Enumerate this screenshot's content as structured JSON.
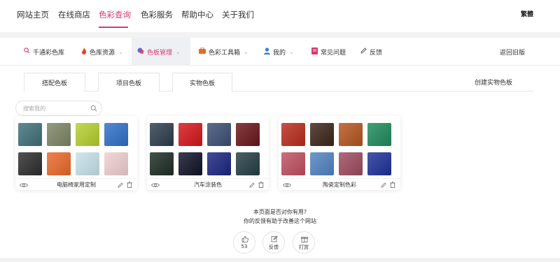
{
  "topnav": {
    "items": [
      "网站主页",
      "在线商店",
      "色彩查询",
      "色彩服务",
      "帮助中心",
      "关于我们"
    ],
    "active": "色彩查询",
    "traditional": "繁體"
  },
  "subnav": {
    "items": [
      {
        "label": "千通彩色库",
        "icon": "search-icon"
      },
      {
        "label": "色库资源",
        "icon": "fire-icon"
      },
      {
        "label": "色板管理",
        "icon": "palette-icon"
      },
      {
        "label": "色彩工具箱",
        "icon": "toolbox-icon"
      },
      {
        "label": "我的",
        "icon": "user-icon"
      },
      {
        "label": "常见问题",
        "icon": "book-icon"
      },
      {
        "label": "反馈",
        "icon": "pencil-icon"
      }
    ],
    "old_version": "返回旧版"
  },
  "tabs": {
    "items": [
      "搭配色板",
      "项目色板",
      "实物色板"
    ],
    "active": "实物色板",
    "create": "创建实物色板"
  },
  "search": {
    "placeholder": "搜索我的"
  },
  "cards": [
    {
      "name": "电脑椅家用定制",
      "swatches": [
        "#3f6f78",
        "#7c8564",
        "#b4cf2e",
        "#2f6fc7",
        "#2c2c2c",
        "#e9682a",
        "#c7e2ea",
        "#efcfd2"
      ]
    },
    {
      "name": "汽车涂装色",
      "swatches": [
        "#2c3c4c",
        "#d4151a",
        "#3a4e73",
        "#6a141a",
        "#1c2c24",
        "#0f1226",
        "#1a2580",
        "#243c44"
      ]
    },
    {
      "name": "陶瓷定制色彩",
      "swatches": [
        "#b92b1c",
        "#3b2418",
        "#b4541e",
        "#1d8a59",
        "#bf4f61",
        "#4f83c1",
        "#9c4a5e",
        "#1e3097"
      ]
    }
  ],
  "feedback": {
    "question": "本页面是否对你有用?",
    "help": "你的反馈有助于改善这个网站",
    "like_count": "53",
    "feedback_label": "反馈",
    "reward_label": "打赏"
  },
  "colors": {
    "accent": "#d83a6e",
    "active_bg": "#eef0f3"
  }
}
